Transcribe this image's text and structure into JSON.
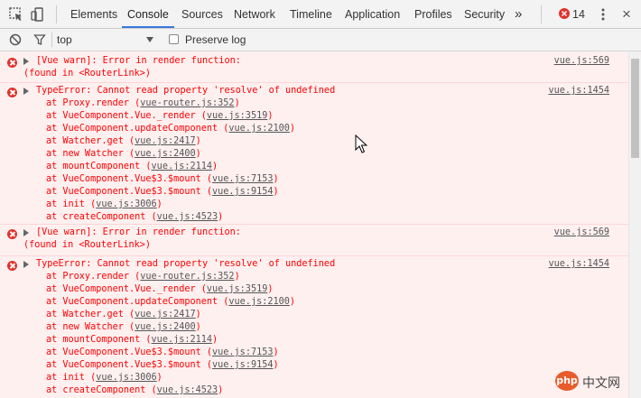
{
  "tabs": [
    "Elements",
    "Console",
    "Sources",
    "Network",
    "Timeline",
    "Application",
    "Profiles",
    "Security"
  ],
  "more": "»",
  "error_count": "14",
  "close": "×",
  "toolbar": {
    "context": "top",
    "preserve_log": "Preserve log"
  },
  "colors": {
    "error_bg": "#fff0f0",
    "error_text": "#ff0000",
    "link": "#555555",
    "active_tab": "#3879d9"
  },
  "messages": [
    {
      "type": "warn",
      "text": "[Vue warn]: Error in render function:",
      "detail": "(found in <RouterLink>)",
      "source": "vue.js:569"
    },
    {
      "type": "error",
      "text": "TypeError: Cannot read property 'resolve' of undefined",
      "source": "vue.js:1454",
      "stack": [
        {
          "fn": "at Proxy.render (",
          "loc": "vue-router.js:352"
        },
        {
          "fn": "at VueComponent.Vue._render (",
          "loc": "vue.js:3519"
        },
        {
          "fn": "at VueComponent.updateComponent (",
          "loc": "vue.js:2100"
        },
        {
          "fn": "at Watcher.get (",
          "loc": "vue.js:2417"
        },
        {
          "fn": "at new Watcher (",
          "loc": "vue.js:2400"
        },
        {
          "fn": "at mountComponent (",
          "loc": "vue.js:2114"
        },
        {
          "fn": "at VueComponent.Vue$3.$mount (",
          "loc": "vue.js:7153"
        },
        {
          "fn": "at VueComponent.Vue$3.$mount (",
          "loc": "vue.js:9154"
        },
        {
          "fn": "at init (",
          "loc": "vue.js:3006"
        },
        {
          "fn": "at createComponent (",
          "loc": "vue.js:4523"
        }
      ]
    },
    {
      "type": "warn",
      "text": "[Vue warn]: Error in render function:",
      "detail": "(found in <RouterLink>)",
      "source": "vue.js:569"
    },
    {
      "type": "error",
      "text": "TypeError: Cannot read property 'resolve' of undefined",
      "source": "vue.js:1454",
      "stack": [
        {
          "fn": "at Proxy.render (",
          "loc": "vue-router.js:352"
        },
        {
          "fn": "at VueComponent.Vue._render (",
          "loc": "vue.js:3519"
        },
        {
          "fn": "at VueComponent.updateComponent (",
          "loc": "vue.js:2100"
        },
        {
          "fn": "at Watcher.get (",
          "loc": "vue.js:2417"
        },
        {
          "fn": "at new Watcher (",
          "loc": "vue.js:2400"
        },
        {
          "fn": "at mountComponent (",
          "loc": "vue.js:2114"
        },
        {
          "fn": "at VueComponent.Vue$3.$mount (",
          "loc": "vue.js:7153"
        },
        {
          "fn": "at VueComponent.Vue$3.$mount (",
          "loc": "vue.js:9154"
        },
        {
          "fn": "at init (",
          "loc": "vue.js:3006"
        },
        {
          "fn": "at createComponent (",
          "loc": "vue.js:4523"
        }
      ]
    }
  ],
  "watermark": {
    "logo": "php",
    "text": "中文网"
  }
}
